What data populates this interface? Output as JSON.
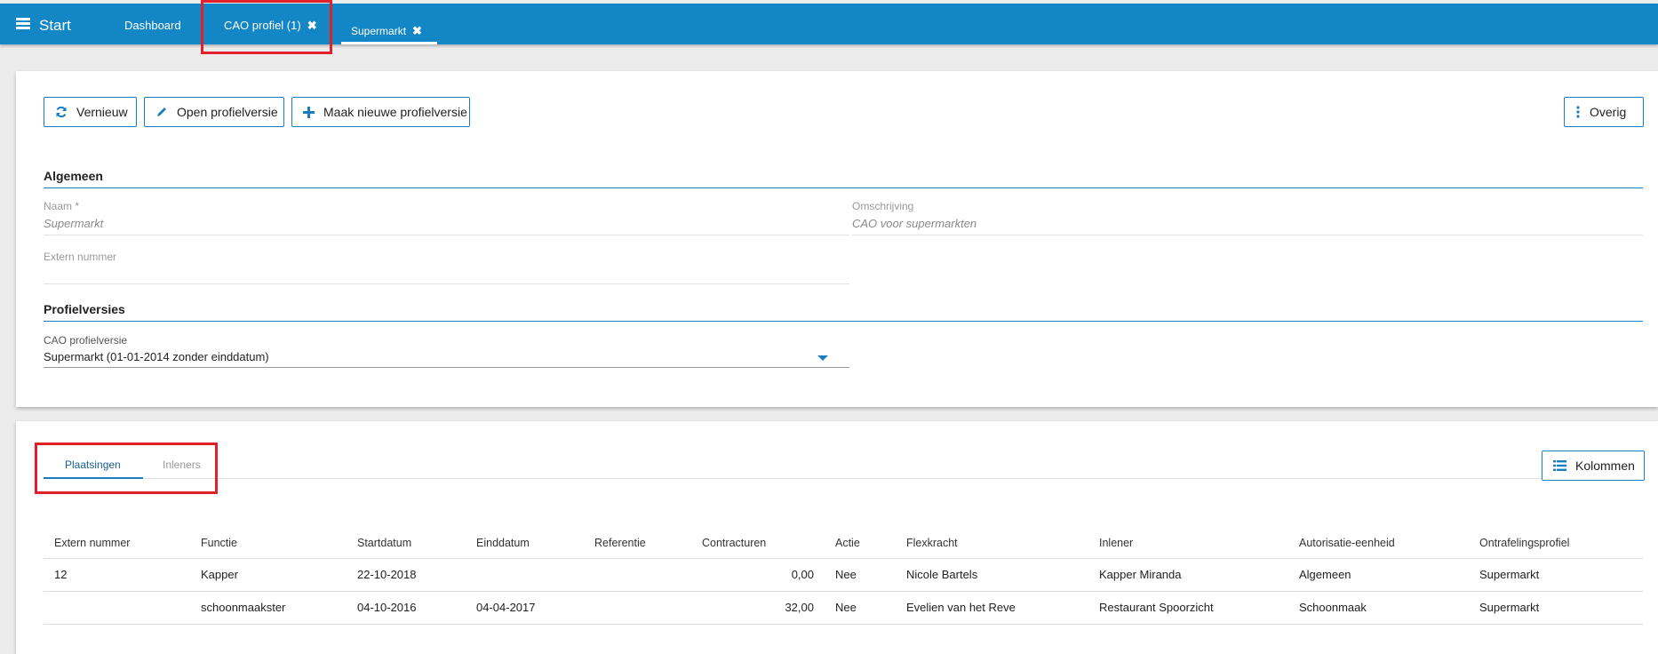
{
  "topbar": {
    "start_label": "Start",
    "tabs": [
      {
        "label": "Dashboard"
      },
      {
        "label": "CAO profiel (1)",
        "close": "✖"
      },
      {
        "label": "Supermarkt",
        "close": "✖"
      }
    ]
  },
  "toolbar": {
    "refresh_label": "Vernieuw",
    "open_label": "Open profielversie",
    "new_label": "Maak nieuwe profielversie",
    "more_label": "Overig"
  },
  "general": {
    "title": "Algemeen",
    "name_label": "Naam *",
    "name_value": "Supermarkt",
    "description_label": "Omschrijving",
    "description_value": "CAO voor supermarkten",
    "external_label": "Extern nummer",
    "external_value": ""
  },
  "profile_versions": {
    "title": "Profielversies",
    "select_label": "CAO profielversie",
    "select_value": "Supermarkt (01-01-2014 zonder einddatum)"
  },
  "bottom": {
    "tabs": [
      {
        "label": "Plaatsingen"
      },
      {
        "label": "Inleners"
      }
    ],
    "columns_label": "Kolommen",
    "table": {
      "headers": [
        "Extern nummer",
        "Functie",
        "Startdatum",
        "Einddatum",
        "Referentie",
        "Contracturen",
        "Actie",
        "Flexkracht",
        "Inlener",
        "Autorisatie-eenheid",
        "Ontrafelingsprofiel"
      ],
      "rows": [
        [
          "12",
          "Kapper",
          "22-10-2018",
          "",
          "",
          "0,00",
          "Nee",
          "Nicole Bartels",
          "Kapper Miranda",
          "Algemeen",
          "Supermarkt"
        ],
        [
          "",
          "schoonmaakster",
          "04-10-2016",
          "04-04-2017",
          "",
          "32,00",
          "Nee",
          "Evelien van het Reve",
          "Restaurant Spoorzicht",
          "Schoonmaak",
          "Supermarkt"
        ]
      ]
    }
  },
  "colors": {
    "brand": "#1386c5",
    "highlight": "#e0202a"
  }
}
